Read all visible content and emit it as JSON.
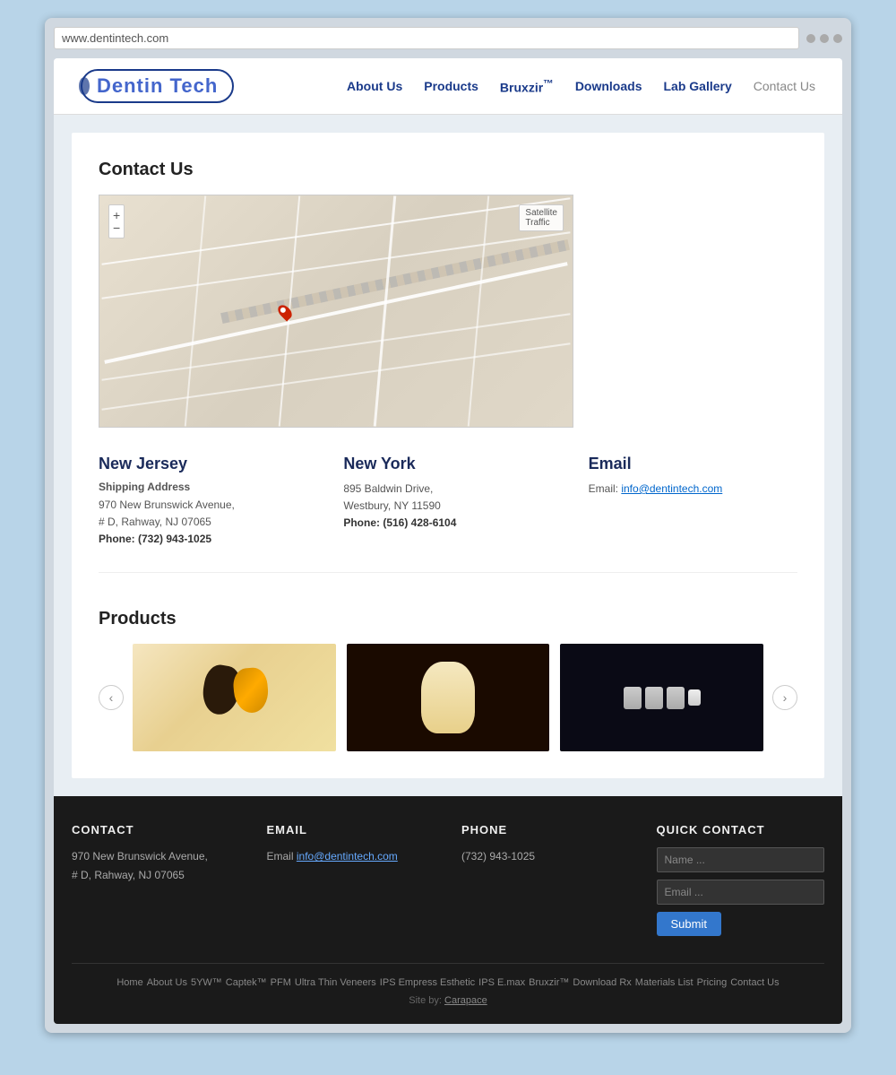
{
  "browser": {
    "url": "www.dentintech.com"
  },
  "site": {
    "title": "Dentin Tech"
  },
  "nav": {
    "items": [
      {
        "label": "About Us",
        "id": "about"
      },
      {
        "label": "Products",
        "id": "products"
      },
      {
        "label": "Bruxzir™",
        "id": "bruxzir"
      },
      {
        "label": "Downloads",
        "id": "downloads"
      },
      {
        "label": "Lab Gallery",
        "id": "gallery"
      },
      {
        "label": "Contact Us",
        "id": "contact"
      }
    ]
  },
  "contact": {
    "section_title": "Contact Us",
    "nj": {
      "title": "New Jersey",
      "subtitle": "Shipping Address",
      "address1": "970 New Brunswick Avenue,",
      "address2": "# D, Rahway, NJ 07065",
      "phone": "Phone: (732) 943-1025"
    },
    "ny": {
      "title": "New York",
      "address1": "895 Baldwin Drive,",
      "address2": "Westbury, NY 11590",
      "phone": "Phone: (516) 428-6104"
    },
    "email": {
      "title": "Email",
      "label": "Email:",
      "address": "info@dentintech.com"
    }
  },
  "products": {
    "section_title": "Products",
    "prev_btn": "‹",
    "next_btn": "›"
  },
  "footer": {
    "contact": {
      "title": "CONTACT",
      "address1": "970 New Brunswick Avenue,",
      "address2": "# D, Rahway, NJ 07065"
    },
    "email": {
      "title": "EMAIL",
      "label": "Email",
      "address": "info@dentintech.com"
    },
    "phone": {
      "title": "PHONE",
      "number": "(732) 943-1025"
    },
    "quick_contact": {
      "title": "QUICK CONTACT",
      "name_placeholder": "Name ...",
      "email_placeholder": "Email ...",
      "submit_label": "Submit"
    },
    "bottom_links": [
      "Home",
      "About Us",
      "5YW™",
      "Captek™",
      "PFM",
      "Ultra Thin Veneers",
      "IPS Empress Esthetic",
      "IPS E.max",
      "Bruxzir™",
      "Download Rx",
      "Materials List",
      "Pricing",
      "Contact Us"
    ],
    "site_by": "Site by:",
    "site_by_link": "Carapace"
  }
}
